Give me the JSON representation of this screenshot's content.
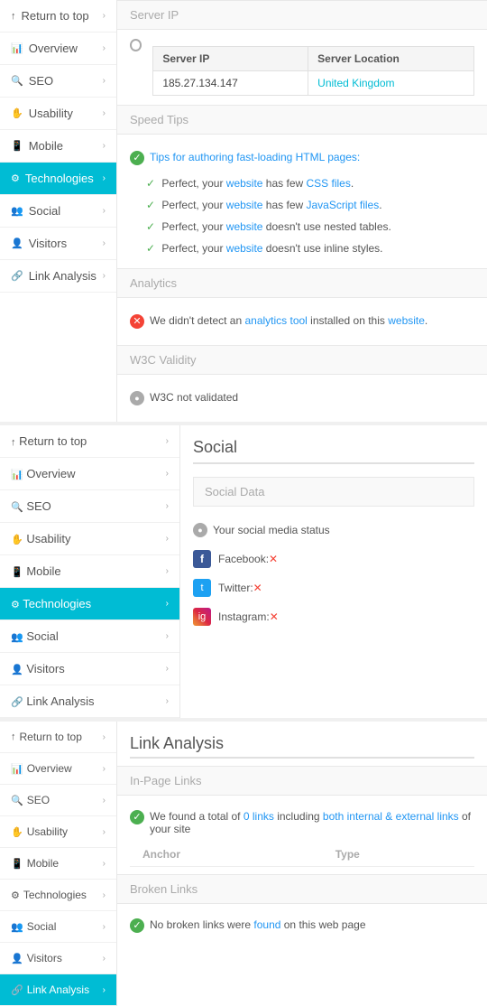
{
  "sidebar1": {
    "items": [
      {
        "label": "Return to top",
        "icon": "↑",
        "active": false
      },
      {
        "label": "Overview",
        "icon": "📊",
        "active": false
      },
      {
        "label": "SEO",
        "icon": "🔍",
        "active": false
      },
      {
        "label": "Usability",
        "icon": "✋",
        "active": false
      },
      {
        "label": "Mobile",
        "icon": "📱",
        "active": false
      },
      {
        "label": "Technologies",
        "icon": "⚙",
        "active": true
      },
      {
        "label": "Social",
        "icon": "👥",
        "active": false
      },
      {
        "label": "Visitors",
        "icon": "👤",
        "active": false
      },
      {
        "label": "Link Analysis",
        "icon": "🔗",
        "active": false
      }
    ]
  },
  "server_ip": {
    "section_title": "Server IP",
    "table": {
      "col1": "Server IP",
      "col2": "Server Location",
      "row1_ip": "185.27.134.147",
      "row1_loc": "United Kingdom"
    }
  },
  "speed_tips": {
    "section_title": "Speed Tips",
    "main_tip": "Tips for authoring fast-loading HTML pages:",
    "items": [
      "Perfect, your website has few CSS files.",
      "Perfect, your website has few JavaScript files.",
      "Perfect, your website doesn't use nested tables.",
      "Perfect, your website doesn't use inline styles."
    ]
  },
  "analytics": {
    "section_title": "Analytics",
    "message": "We didn't detect an analytics tool installed on this website."
  },
  "w3c": {
    "section_title": "W3C Validity",
    "message": "W3C not validated"
  },
  "sidebar2": {
    "items": [
      {
        "label": "Return to top",
        "icon": "↑",
        "active": false
      },
      {
        "label": "Overview",
        "icon": "📊",
        "active": false
      },
      {
        "label": "SEO",
        "icon": "🔍",
        "active": false
      },
      {
        "label": "Usability",
        "icon": "✋",
        "active": false
      },
      {
        "label": "Mobile",
        "icon": "📱",
        "active": false
      },
      {
        "label": "Technologies",
        "icon": "⚙",
        "active": true
      },
      {
        "label": "Social",
        "icon": "👥",
        "active": false
      },
      {
        "label": "Visitors",
        "icon": "👤",
        "active": false
      },
      {
        "label": "Link Analysis",
        "icon": "🔗",
        "active": false
      }
    ]
  },
  "social": {
    "title": "Social",
    "section_title": "Social Data",
    "status_label": "Your social media status",
    "networks": [
      {
        "name": "Facebook:",
        "status": "✕",
        "platform": "fb"
      },
      {
        "name": "Twitter:",
        "status": "✕",
        "platform": "tw"
      },
      {
        "name": "Instagram:",
        "status": "✕",
        "platform": "ig"
      }
    ]
  },
  "sidebar3": {
    "items": [
      {
        "label": "Return to top",
        "icon": "↑",
        "active": false
      },
      {
        "label": "Overview",
        "icon": "📊",
        "active": false
      },
      {
        "label": "SEO",
        "icon": "🔍",
        "active": false
      },
      {
        "label": "Usability",
        "icon": "✋",
        "active": false
      },
      {
        "label": "Mobile",
        "icon": "📱",
        "active": false
      },
      {
        "label": "Technologies",
        "icon": "⚙",
        "active": false
      },
      {
        "label": "Social",
        "icon": "👥",
        "active": false
      },
      {
        "label": "Visitors",
        "icon": "👤",
        "active": false
      },
      {
        "label": "Link Analysis",
        "icon": "🔗",
        "active": true
      }
    ]
  },
  "link_analysis": {
    "title": "Link Analysis",
    "in_page": {
      "section_title": "In-Page Links",
      "message": "We found a total of 0 links including both internal & external links of your site",
      "col1": "Anchor",
      "col2": "Type"
    },
    "broken": {
      "section_title": "Broken Links",
      "message": "No broken links were found on this web page"
    }
  }
}
